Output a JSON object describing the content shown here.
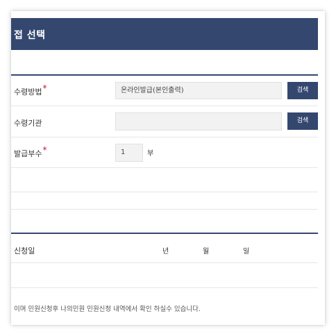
{
  "title_bar": {
    "title": "접 선택"
  },
  "form": {
    "receive_method": {
      "label": "수령방법",
      "required_mark": "*",
      "value": "온라인발급(본인출력)",
      "search_label": "검색"
    },
    "receive_agency": {
      "label": "수령기관",
      "value": "",
      "search_label": "검색"
    },
    "copies": {
      "label": "발급부수",
      "required_mark": "*",
      "value": "1",
      "unit": "부"
    }
  },
  "application_date": {
    "label": "신청일",
    "year_label": "년",
    "month_label": "월",
    "day_label": "일"
  },
  "notice": "이며 민원신청후 나의민원 민원신청 내역에서 확인 하실수 있습니다.",
  "colors": {
    "header": "#34476f",
    "button": "#34476f",
    "required": "#c8102e"
  }
}
